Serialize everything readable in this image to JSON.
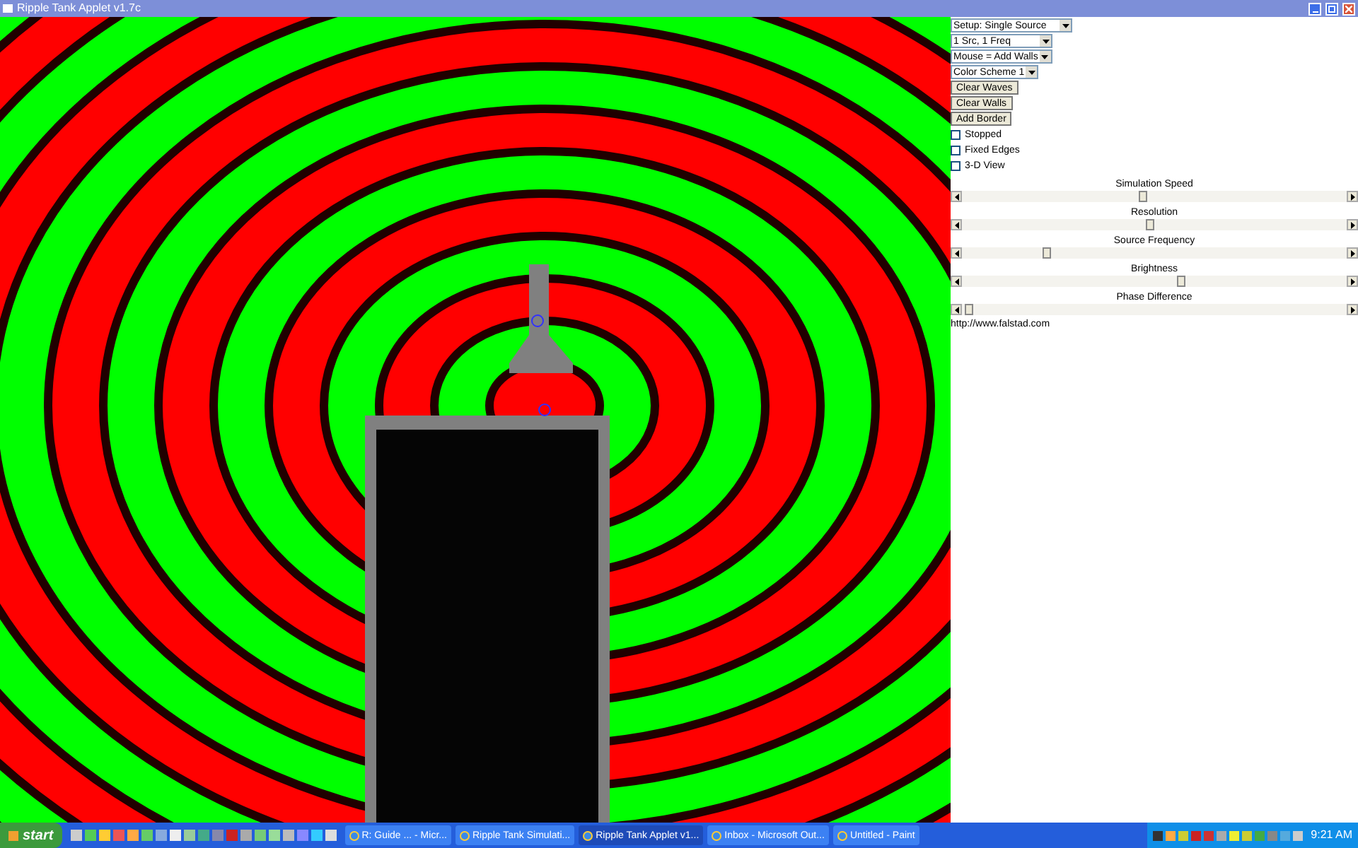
{
  "window": {
    "title": "Ripple Tank Applet v1.7c"
  },
  "panel": {
    "dropdowns": [
      {
        "value": "Setup: Single Source"
      },
      {
        "value": "1 Src, 1 Freq"
      },
      {
        "value": "Mouse = Add Walls"
      },
      {
        "value": "Color Scheme 1"
      }
    ],
    "buttons": [
      "Clear Waves",
      "Clear Walls",
      "Add Border"
    ],
    "checkboxes": [
      {
        "label": "Stopped",
        "checked": false
      },
      {
        "label": "Fixed Edges",
        "checked": false
      },
      {
        "label": "3-D View",
        "checked": false
      }
    ],
    "sliders": [
      {
        "label": "Simulation Speed",
        "level": 0.47
      },
      {
        "label": "Resolution",
        "level": 0.49
      },
      {
        "label": "Source Frequency",
        "level": 0.22
      },
      {
        "label": "Brightness",
        "level": 0.57
      },
      {
        "label": "Phase Difference",
        "level": 0.02
      }
    ],
    "link": "http://www.falstad.com"
  },
  "taskbar": {
    "start": "start",
    "tasks": [
      {
        "label": "R: Guide ... - Micr...",
        "selected": false
      },
      {
        "label": "Ripple Tank Simulati...",
        "selected": false
      },
      {
        "label": "Ripple Tank Applet v1...",
        "selected": true
      },
      {
        "label": "Inbox - Microsoft Out...",
        "selected": false
      },
      {
        "label": "Untitled - Paint",
        "selected": false
      }
    ],
    "clock": "9:21 AM"
  }
}
